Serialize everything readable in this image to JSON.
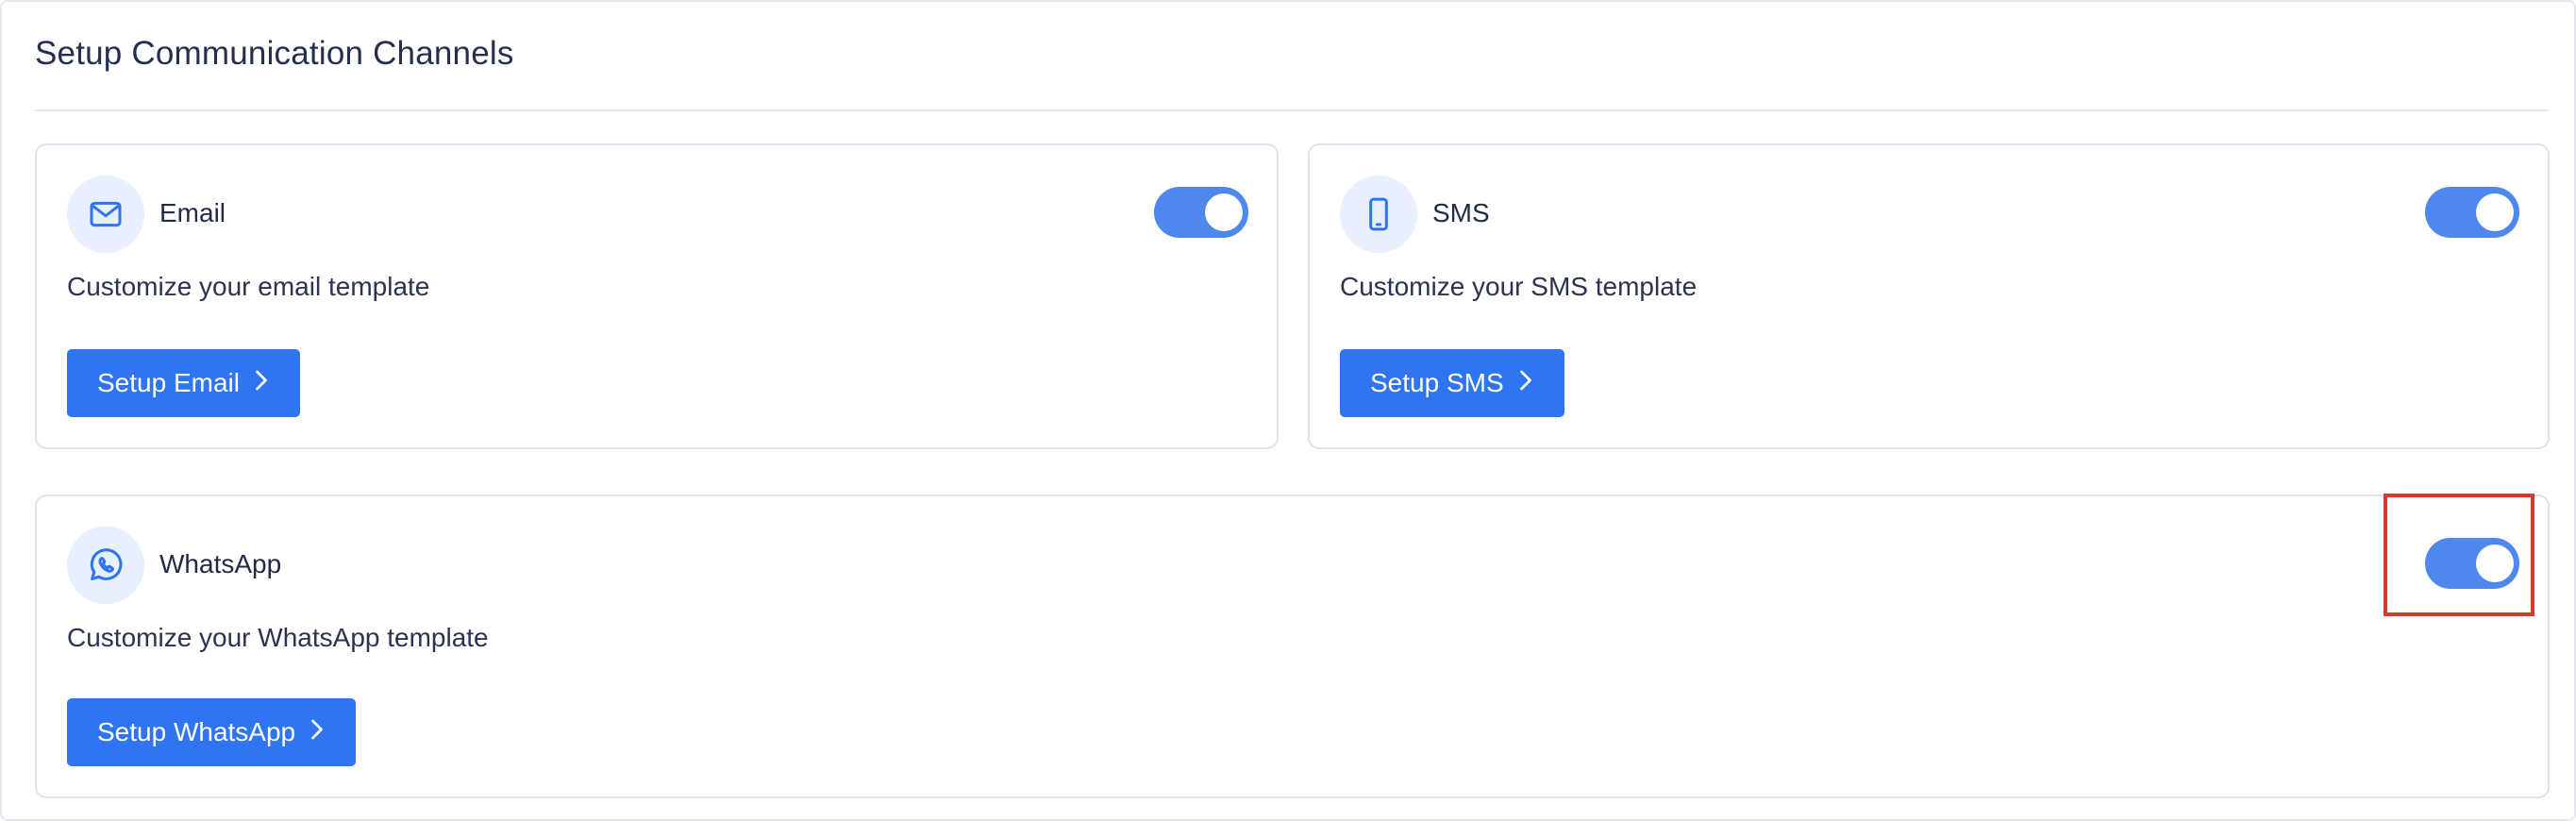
{
  "page": {
    "title": "Setup Communication Channels"
  },
  "channels": [
    {
      "name": "Email",
      "icon": "mail-icon",
      "description": "Customize your email template",
      "button_label": "Setup Email",
      "enabled": true
    },
    {
      "name": "SMS",
      "icon": "mobile-phone-icon",
      "description": "Customize your SMS template",
      "button_label": "Setup SMS",
      "enabled": true
    },
    {
      "name": "WhatsApp",
      "icon": "whatsapp-icon",
      "description": "Customize your WhatsApp template",
      "button_label": "Setup WhatsApp",
      "enabled": true
    }
  ],
  "colors": {
    "accent": "#2f74f2",
    "toggle_on": "#4e88ec",
    "icon_bg": "#e8f0fd",
    "highlight": "#d93a2b"
  }
}
